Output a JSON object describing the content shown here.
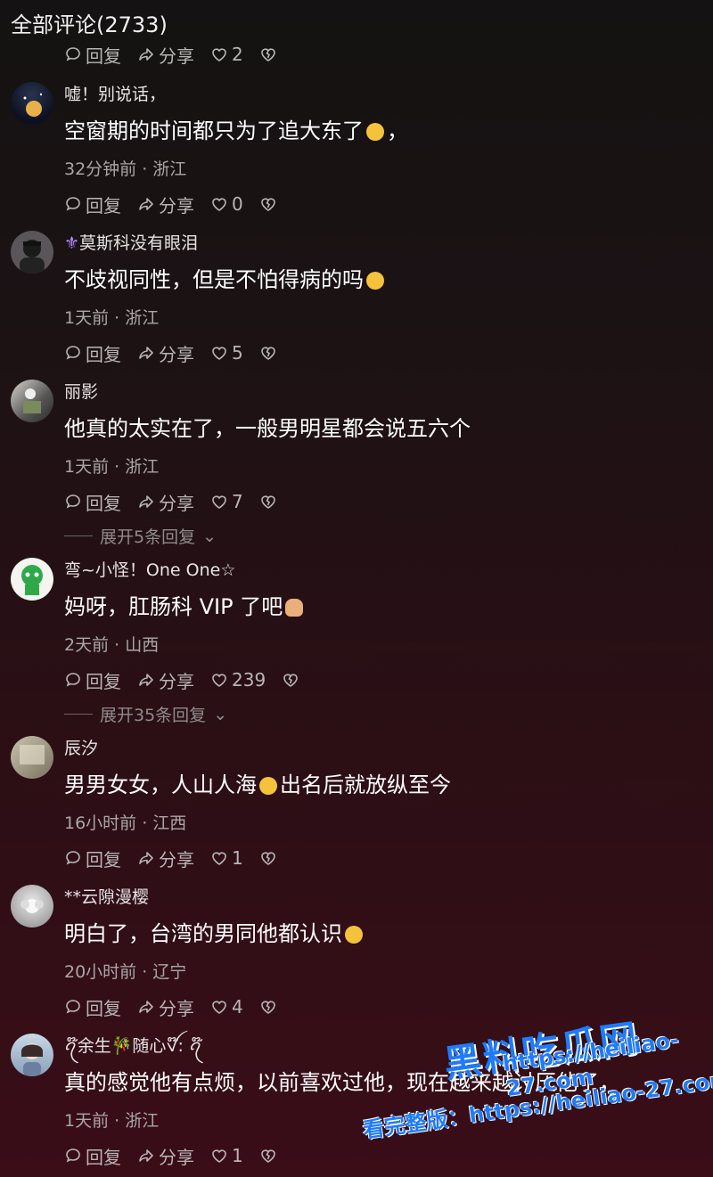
{
  "header": {
    "title": "全部评论(2733)"
  },
  "top_actions": {
    "reply": "回复",
    "share": "分享",
    "likes": "2"
  },
  "comments": [
    {
      "name": "嘘！别说话，",
      "text": "空窗期的时间都只为了追大东了",
      "text_suffix": "，",
      "meta": "32分钟前 · 浙江",
      "reply": "回复",
      "share": "分享",
      "likes": "0"
    },
    {
      "name": "莫斯科没有眼泪",
      "text": "不歧视同性，但是不怕得病的吗",
      "text_suffix": "",
      "meta": "1天前 · 浙江",
      "reply": "回复",
      "share": "分享",
      "likes": "5"
    },
    {
      "name": "丽影",
      "text": "他真的太实在了，一般男明星都会说五六个",
      "text_suffix": "",
      "meta": "1天前 · 浙江",
      "reply": "回复",
      "share": "分享",
      "likes": "7",
      "expand": "展开5条回复"
    },
    {
      "name": "弯~小怪！One One☆",
      "text": "妈呀，肛肠科 VIP 了吧",
      "text_suffix": "",
      "meta": "2天前 · 山西",
      "reply": "回复",
      "share": "分享",
      "likes": "239",
      "expand": "展开35条回复"
    },
    {
      "name": "辰汐",
      "text": "男男女女，人山人海",
      "text_suffix": "出名后就放纵至今",
      "meta": "16小时前 · 江西",
      "reply": "回复",
      "share": "分享",
      "likes": "1"
    },
    {
      "name": "**云隙漫樱",
      "text": "明白了，台湾的男同他都认识",
      "text_suffix": "",
      "meta": "20小时前 · 辽宁",
      "reply": "回复",
      "share": "分享",
      "likes": "4"
    },
    {
      "name": "ꪖ໊余生🎋随心ꪜ໊: ꪖ໊",
      "text": "真的感觉他有点烦，以前喜欢过他，现在越来越讨厌他了，",
      "text_suffix": "",
      "meta": "1天前 · 浙江",
      "reply": "回复",
      "share": "分享",
      "likes": "1"
    }
  ],
  "watermark": {
    "logo": "黑料吃瓜网",
    "url": "https://heiliao-27.com",
    "see_full": "看完整版：https://heiliao-27.com"
  },
  "colors": {
    "accent": "#1e7bff",
    "text_muted": "#a9a6a7"
  }
}
